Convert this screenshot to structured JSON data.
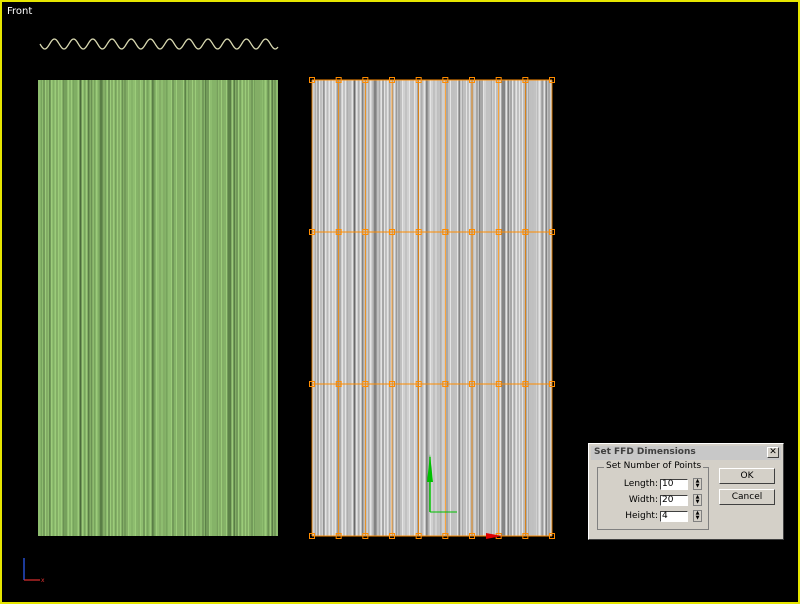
{
  "viewport": {
    "label": "Front"
  },
  "dialog": {
    "title": "Set FFD Dimensions",
    "close_glyph": "✕",
    "group_label": "Set Number of Points",
    "fields": [
      {
        "label": "Length:",
        "value": "10"
      },
      {
        "label": "Width:",
        "value": "20"
      },
      {
        "label": "Height:",
        "value": "4"
      }
    ],
    "ok_label": "OK",
    "cancel_label": "Cancel"
  },
  "colors": {
    "viewport_border": "#e6e600",
    "green_mesh": "#9ccc7a",
    "white_mesh": "#dcdcdc",
    "lattice": "#ff8c00",
    "gizmo_y": "#00c000",
    "gizmo_x": "#e00000"
  },
  "icons": [
    "wave-curve-icon",
    "axis-tripod-icon",
    "transform-gizmo-icon"
  ]
}
